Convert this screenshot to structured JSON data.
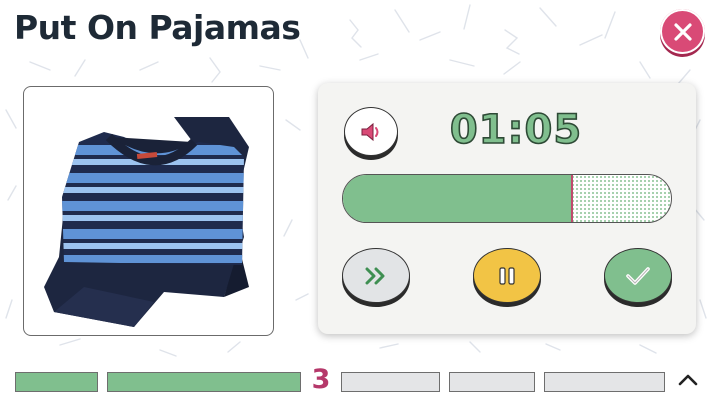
{
  "activity": {
    "title": "Put On Pajamas"
  },
  "timer": {
    "display": "01:05",
    "progress_fraction": 0.7
  },
  "controls": {
    "sound_icon": "speaker-icon",
    "skip_icon": "double-chevron-right-icon",
    "pause_icon": "pause-icon",
    "done_icon": "checkmark-icon",
    "close_icon": "close-icon"
  },
  "steps": {
    "current_number": "3",
    "completed": 2,
    "remaining": 3
  },
  "colors": {
    "green": "#80bf8e",
    "pink": "#d94a76",
    "yellow": "#f2c445",
    "gray": "#e2e4e6",
    "title": "#1e2a36"
  }
}
